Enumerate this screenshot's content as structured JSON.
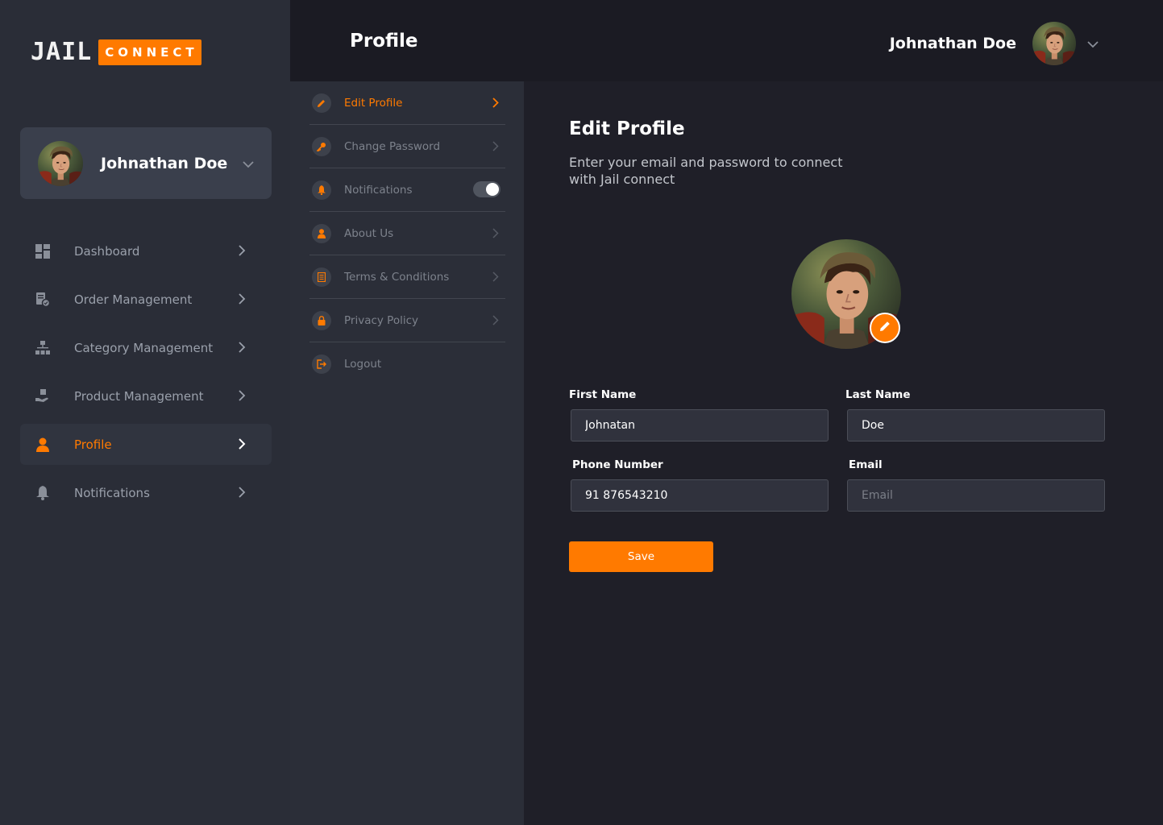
{
  "brand": {
    "logo_left": "JAIL",
    "logo_right": "CONNECT",
    "accent": "#ff7a00"
  },
  "sidebar": {
    "user_name": "Johnathan Doe",
    "items": [
      {
        "label": "Dashboard",
        "icon": "dashboard-icon",
        "active": false
      },
      {
        "label": "Order Management",
        "icon": "order-icon",
        "active": false
      },
      {
        "label": "Category Management",
        "icon": "category-icon",
        "active": false
      },
      {
        "label": "Product Management",
        "icon": "product-icon",
        "active": false
      },
      {
        "label": "Profile",
        "icon": "user-icon",
        "active": true
      },
      {
        "label": "Notifications",
        "icon": "bell-icon",
        "active": false
      }
    ]
  },
  "header": {
    "title": "Profile",
    "user_name": "Johnathan Doe"
  },
  "settings_menu": {
    "items": [
      {
        "label": "Edit Profile",
        "icon": "pencil-icon",
        "active": true
      },
      {
        "label": "Change Password",
        "icon": "key-icon"
      },
      {
        "label": "Notifications",
        "icon": "bell-icon",
        "toggle_on": true
      },
      {
        "label": "About Us",
        "icon": "user-icon"
      },
      {
        "label": "Terms & Conditions",
        "icon": "document-icon"
      },
      {
        "label": "Privacy Policy",
        "icon": "lock-icon"
      },
      {
        "label": "Logout",
        "icon": "logout-icon"
      }
    ]
  },
  "form": {
    "title": "Edit Profile",
    "description": "Enter your email and password to connect with Jail connect",
    "first_name_label": "First Name",
    "first_name_value": "Johnatan",
    "last_name_label": "Last Name",
    "last_name_value": "Doe",
    "phone_label": "Phone Number",
    "phone_value": "91 876543210",
    "email_label": "Email",
    "email_value": "",
    "email_placeholder": "Email",
    "save_label": "Save"
  }
}
